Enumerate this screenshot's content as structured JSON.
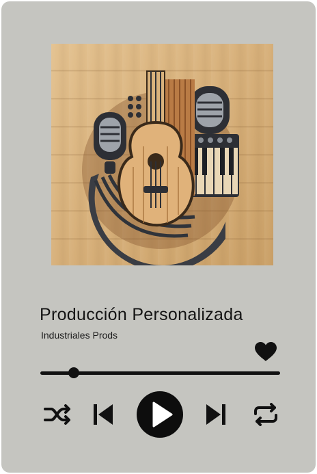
{
  "track": {
    "title": "Producción Personalizada",
    "artist": "Industriales Prods",
    "liked": true,
    "progress": 0.14
  },
  "cover_art": {
    "icon": "guitar-piano-microphone-artwork-icon"
  },
  "controls": {
    "shuffle_icon": "shuffle-icon",
    "previous_icon": "skip-previous-icon",
    "play_icon": "play-icon",
    "next_icon": "skip-next-icon",
    "repeat_icon": "repeat-icon",
    "like_icon": "heart-icon"
  },
  "colors": {
    "card_background": "#c5c5c0",
    "foreground": "#111111",
    "wood": "#d7b07a"
  }
}
